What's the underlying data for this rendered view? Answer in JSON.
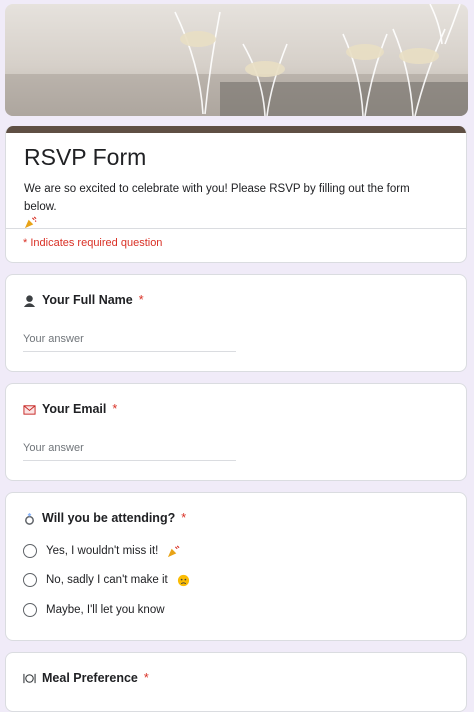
{
  "form": {
    "title": "RSVP Form",
    "description": "We are so excited to celebrate with you! Please RSVP by filling out the form below.",
    "required_note": "* Indicates required question"
  },
  "questions": [
    {
      "icon": "person-silhouette-icon",
      "title": "Your Full Name",
      "required_mark": "*",
      "placeholder": "Your answer"
    },
    {
      "icon": "envelope-icon",
      "title": "Your Email",
      "required_mark": "*",
      "placeholder": "Your answer"
    },
    {
      "icon": "ring-icon",
      "title": "Will you be attending?",
      "required_mark": "*",
      "options": [
        "Yes, I wouldn't miss it!",
        "No, sadly I can't make it",
        "Maybe, I'll let you know"
      ]
    },
    {
      "icon": "fork-knife-plate-icon",
      "title": "Meal Preference",
      "required_mark": "*"
    }
  ],
  "colors": {
    "theme_bar": "#5f4f44",
    "page_bg": "#f0ebf8",
    "required": "#d93025"
  }
}
